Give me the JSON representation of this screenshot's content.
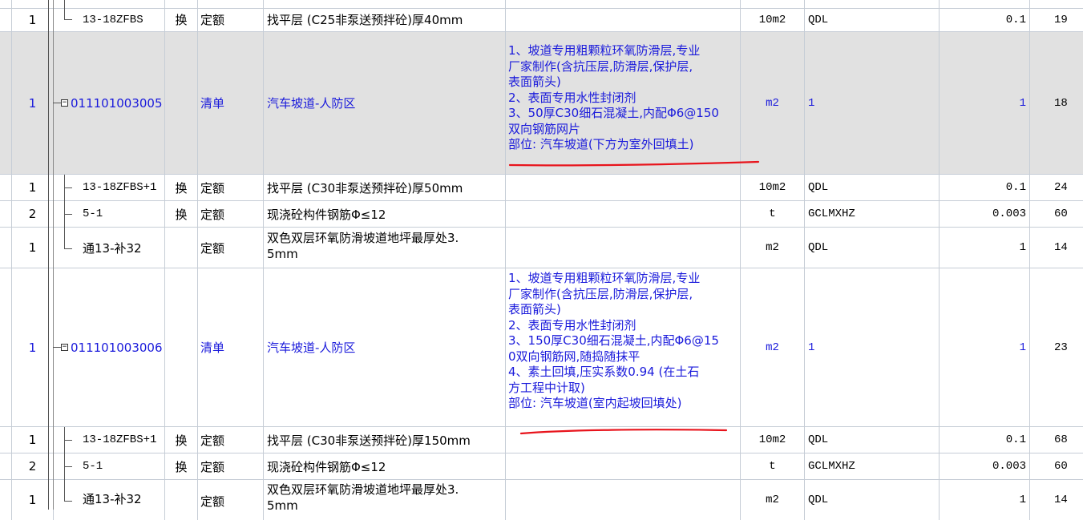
{
  "rows": [
    {
      "level": "1",
      "code": "13-18ZFBS",
      "huan": "换",
      "type": "定额",
      "name": "找平层 (C25非泵送预拌砼)厚40mm",
      "feature": "",
      "unit": "10m2",
      "expr": "QDL",
      "qty": "0.1",
      "extra": "19"
    },
    {
      "level": "1",
      "code": "011101003005",
      "huan": "",
      "type": "清单",
      "name": "汽车坡道-人防区",
      "feature": [
        "1、坡道专用粗颗粒环氧防滑层,专业",
        "厂家制作(含抗压层,防滑层,保护层,",
        "表面箭头)",
        "2、表面专用水性封闭剂",
        "3、50厚C30细石混凝土,内配Φ6@150",
        "双向钢筋网片",
        "部位: 汽车坡道(下方为室外回填土)"
      ],
      "unit": "m2",
      "expr": "1",
      "qty": "1",
      "extra": "18"
    },
    {
      "level": "1",
      "code": "13-18ZFBS+1",
      "huan": "换",
      "type": "定额",
      "name": "找平层 (C30非泵送预拌砼)厚50mm",
      "feature": "",
      "unit": "10m2",
      "expr": "QDL",
      "qty": "0.1",
      "extra": "24"
    },
    {
      "level": "2",
      "code": "5-1",
      "huan": "换",
      "type": "定额",
      "name": "现浇砼构件钢筋Φ≤12",
      "feature": "",
      "unit": "t",
      "expr": "GCLMXHZ",
      "qty": "0.003",
      "extra": "60"
    },
    {
      "level": "1",
      "code": "通13-补32",
      "huan": "",
      "type": "定额",
      "name": [
        "双色双层环氧防滑坡道地坪最厚处3.",
        "5mm"
      ],
      "feature": "",
      "unit": "m2",
      "expr": "QDL",
      "qty": "1",
      "extra": "14"
    },
    {
      "level": "1",
      "code": "011101003006",
      "huan": "",
      "type": "清单",
      "name": "汽车坡道-人防区",
      "feature": [
        "1、坡道专用粗颗粒环氧防滑层,专业",
        "厂家制作(含抗压层,防滑层,保护层,",
        "表面箭头)",
        "2、表面专用水性封闭剂",
        "3、150厚C30细石混凝土,内配Φ6@15",
        "0双向钢筋网,随捣随抹平",
        "4、素土回填,压实系数0.94 (在土石",
        "方工程中计取)",
        "部位: 汽车坡道(室内起坡回填处)"
      ],
      "unit": "m2",
      "expr": "1",
      "qty": "1",
      "extra": "23"
    },
    {
      "level": "1",
      "code": "13-18ZFBS+1",
      "huan": "换",
      "type": "定额",
      "name": "找平层 (C30非泵送预拌砼)厚150mm",
      "feature": "",
      "unit": "10m2",
      "expr": "QDL",
      "qty": "0.1",
      "extra": "68"
    },
    {
      "level": "2",
      "code": "5-1",
      "huan": "换",
      "type": "定额",
      "name": "现浇砼构件钢筋Φ≤12",
      "feature": "",
      "unit": "t",
      "expr": "GCLMXHZ",
      "qty": "0.003",
      "extra": "60"
    },
    {
      "level": "1",
      "code": "通13-补32",
      "huan": "",
      "type": "定额",
      "name": [
        "双色双层环氧防滑坡道地坪最厚处3.",
        "5mm"
      ],
      "feature": "",
      "unit": "m2",
      "expr": "QDL",
      "qty": "1",
      "extra": "14"
    }
  ],
  "colors": {
    "grid": "#c6cdd6",
    "selected_row": "#e1e1e1",
    "bill_text": "#1a1adb",
    "annotation": "#e8141c"
  }
}
